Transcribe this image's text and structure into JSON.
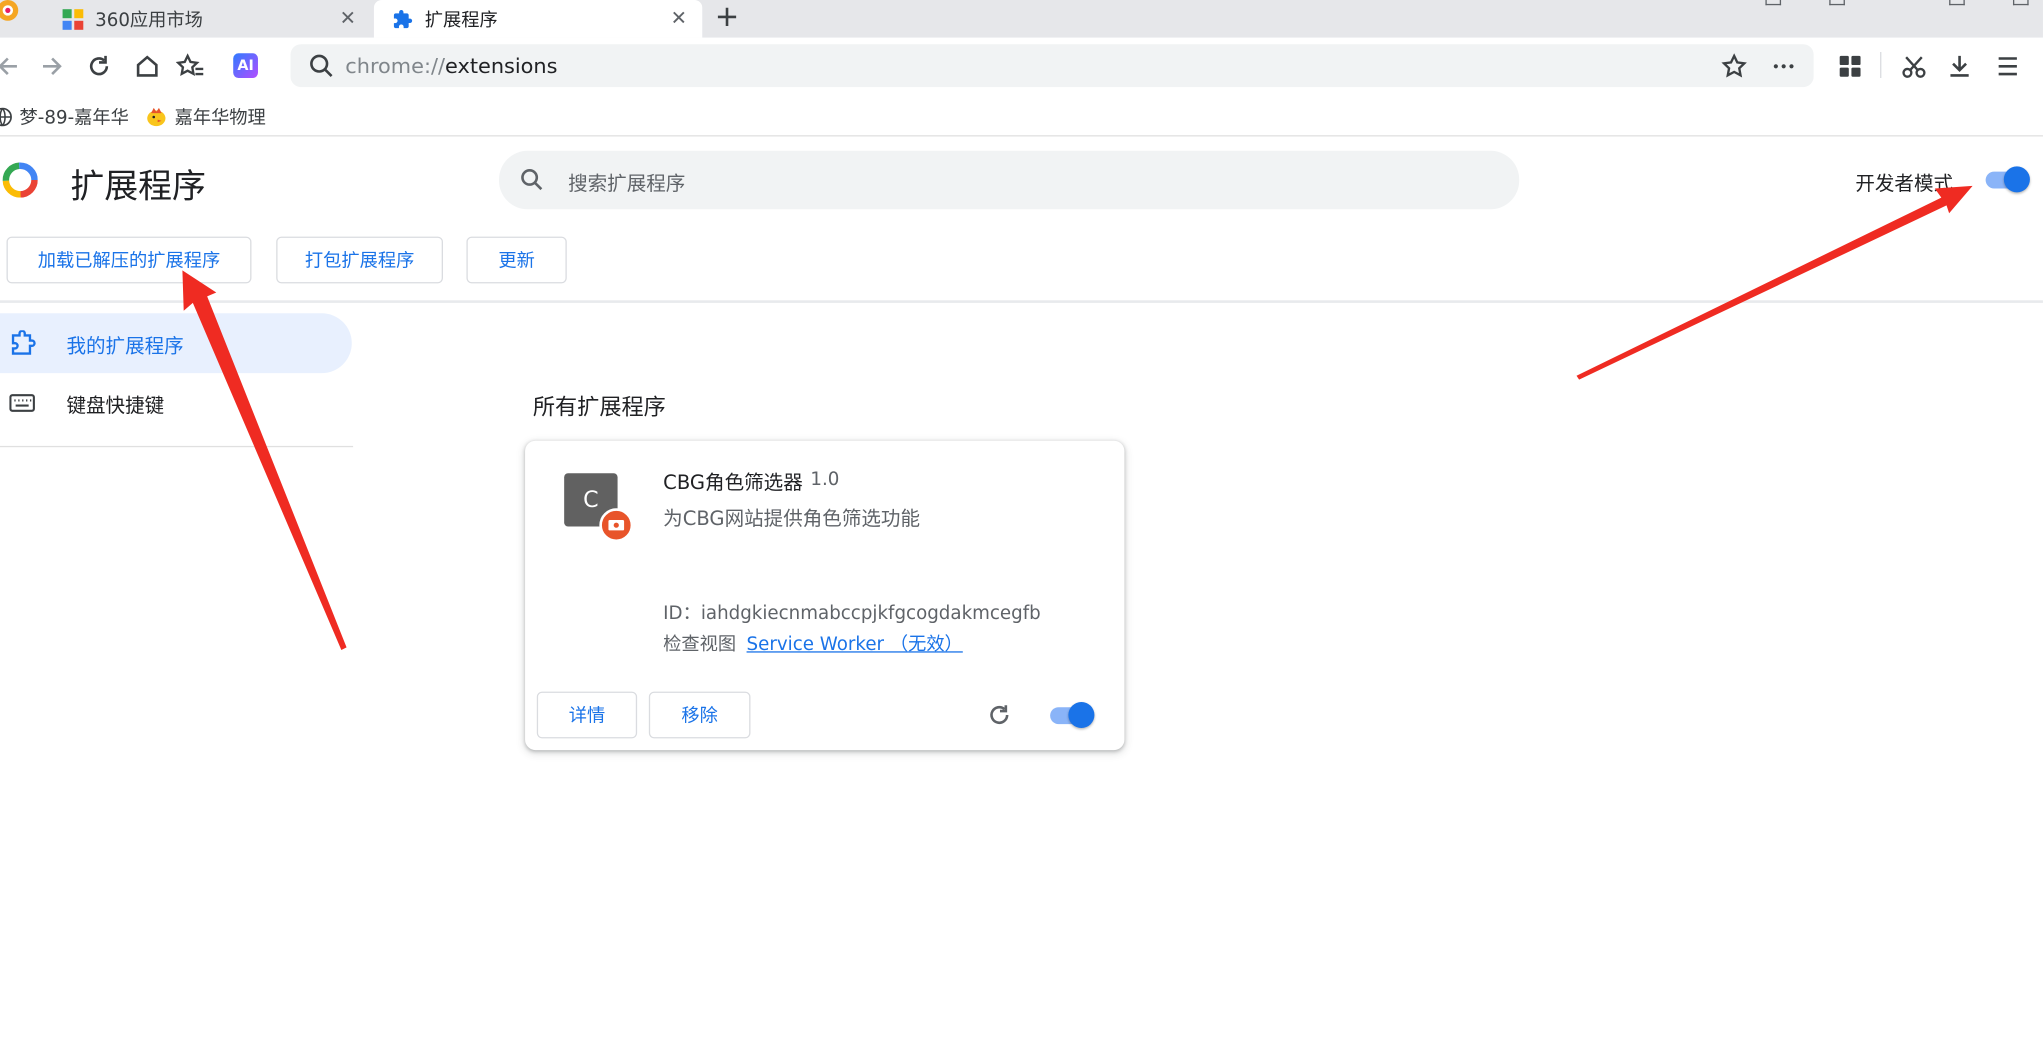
{
  "browser": {
    "tabs": [
      {
        "label": "360应用市场",
        "active": false
      },
      {
        "label": "扩展程序",
        "active": true
      }
    ],
    "address": {
      "scheme": "chrome://",
      "host": "extensions"
    },
    "ai_label": "AI",
    "bookmarks": [
      {
        "label": "梦-89-嘉年华"
      },
      {
        "label": "嘉年华物理"
      }
    ]
  },
  "extensions_page": {
    "title": "扩展程序",
    "search_placeholder": "搜索扩展程序",
    "developer_mode_label": "开发者模式",
    "developer_mode_on": true,
    "actions": {
      "load_unpacked": "加载已解压的扩展程序",
      "pack": "打包扩展程序",
      "update": "更新"
    },
    "nav": [
      {
        "label": "我的扩展程序",
        "active": true
      },
      {
        "label": "键盘快捷键",
        "active": false
      }
    ],
    "section_title": "所有扩展程序",
    "extension": {
      "icon_letter": "C",
      "name": "CBG角色筛选器",
      "version": "1.0",
      "description": "为CBG网站提供角色筛选功能",
      "id_text": "ID：iahdgkiecnmabccpjkfgcogdakmcegfb",
      "inspect_label": "检查视图",
      "inspect_link": "Service Worker （无效）",
      "details_label": "详情",
      "remove_label": "移除",
      "enabled": true
    }
  },
  "colors": {
    "accent": "#1a73e8",
    "annotation_arrow": "#ef2b22"
  }
}
